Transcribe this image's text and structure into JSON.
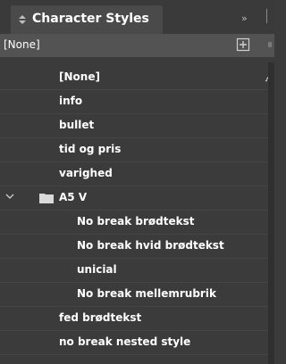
{
  "panel": {
    "title": "Character Styles",
    "collapse_glyph": "»"
  },
  "current_style": {
    "label": "[None]"
  },
  "icons": {
    "tab_icon": "diamond-arrows-icon",
    "collapse_icon": "double-chevron-right-icon",
    "new_style_icon": "new-style-icon",
    "folder_icon": "folder-icon",
    "chevron_icon": "chevron-down-icon",
    "pen_icon": "pen-icon"
  },
  "colors": {
    "panel_bg": "#3b3b3b",
    "row_selected_bg": "#535353",
    "text": "#ffffff"
  },
  "styles": [
    {
      "label": "[None]",
      "level": 1
    },
    {
      "label": "info",
      "level": 1
    },
    {
      "label": "bullet",
      "level": 1
    },
    {
      "label": "tid og pris",
      "level": 1
    },
    {
      "label": "varighed",
      "level": 1
    },
    {
      "label": "A5 V",
      "level": 0,
      "group": true,
      "expanded": true
    },
    {
      "label": "No break brødtekst",
      "level": 2
    },
    {
      "label": "No break hvid brødtekst",
      "level": 2
    },
    {
      "label": "unicial",
      "level": 2
    },
    {
      "label": "No break mellemrubrik",
      "level": 2
    },
    {
      "label": "fed brødtekst",
      "level": 1
    },
    {
      "label": "no break nested style",
      "level": 1
    }
  ]
}
